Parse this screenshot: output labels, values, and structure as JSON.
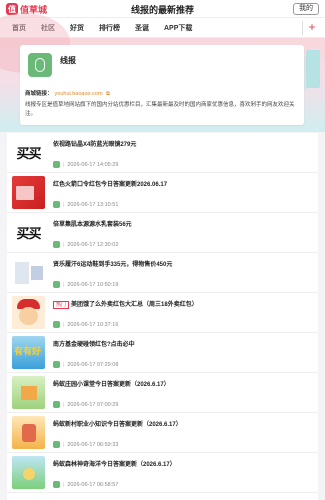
{
  "header": {
    "logo_mark": "值",
    "logo_text": "值草城",
    "title": "线报的最新推荐",
    "my_button": "我的"
  },
  "nav": {
    "items": [
      "首页",
      "社区",
      "好货",
      "排行榜",
      "圣诞",
      "APP下载"
    ],
    "plus": "+"
  },
  "site_card": {
    "name": "线报",
    "link_label": "商城链接：",
    "link": "youhui.baoaoo.com",
    "description": "线报专区是值草地网站旗下的国内分站优惠栏目，汇集最新最及时的国内商家优惠信息，喜欢剁手的网友欢迎关注。"
  },
  "items": [
    {
      "title": "依视路钻晶X4防蓝光眼镜279元",
      "date": "2026-06-17 14:05:29",
      "tag": ""
    },
    {
      "title": "红色火箭口令红包今日答案更新2026.06.17",
      "date": "2026-06-17 13:10:51",
      "tag": ""
    },
    {
      "title": "倍草集肌本源源水乳套装56元",
      "date": "2026-06-17 12:30:02",
      "tag": ""
    },
    {
      "title": "贤乐履汗6运动鞋到手335元，得物售价450元",
      "date": "2026-06-17 10:50:19",
      "tag": ""
    },
    {
      "title": "美团饿了么外卖红包大汇总（周三18外卖红包）",
      "date": "2026-06-17 10:37:16",
      "tag": "热门"
    },
    {
      "title": "南方基金硬碰领红包?点击必中",
      "date": "2026-06-17 07:29:08",
      "tag": ""
    },
    {
      "title": "蚂蚁庄园小课堂今日答案更新（2026.6.17）",
      "date": "2026-06-17 07:00:29",
      "tag": ""
    },
    {
      "title": "蚂蚁新村职业小知识今日答案更新（2026.6.17）",
      "date": "2026-06-17 06:59:33",
      "tag": ""
    },
    {
      "title": "蚂蚁森林神奇海洋今日答案更新（2026.6.17）",
      "date": "2026-06-17 06:58:57",
      "tag": ""
    }
  ],
  "thumbs": {
    "text_glyph": "买买",
    "fund_text": "有有好"
  },
  "colors": {
    "brand": "#e8384f",
    "link": "#e08a2b",
    "green": "#6bb978"
  }
}
